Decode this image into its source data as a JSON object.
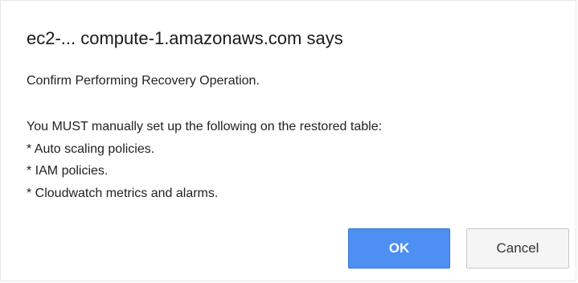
{
  "dialog": {
    "title": "ec2-... compute-1.amazonaws.com says",
    "confirm_text": "Confirm Performing Recovery Operation.",
    "message_lines": [
      "You MUST manually set up the following on the restored table:",
      "* Auto scaling policies.",
      "* IAM policies.",
      "* Cloudwatch metrics and alarms."
    ],
    "ok_label": "OK",
    "cancel_label": "Cancel"
  },
  "colors": {
    "ok_button_bg": "#4d8ff2",
    "cancel_button_bg": "#f5f5f5"
  }
}
